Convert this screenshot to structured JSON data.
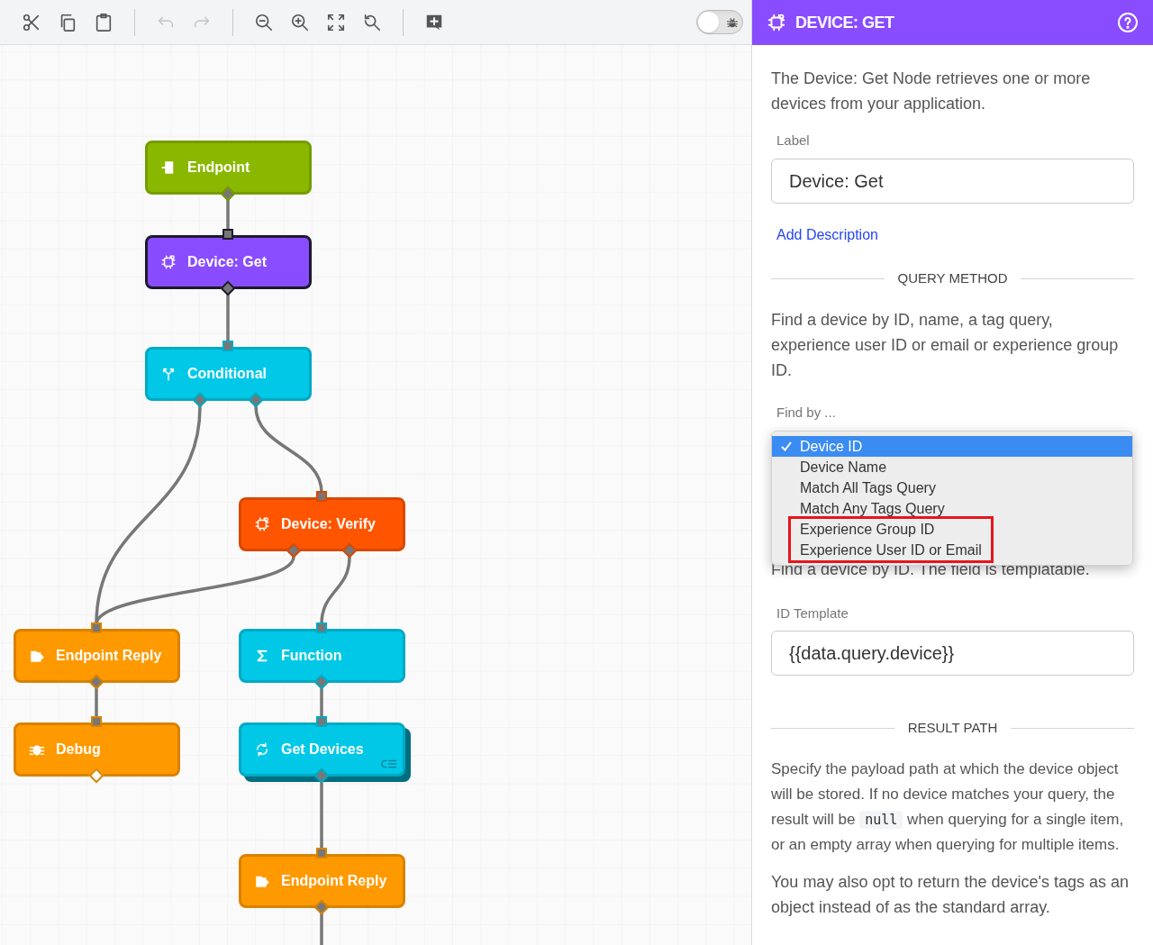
{
  "toolbar": {
    "tools": [
      {
        "kind": "cut",
        "disabled": false
      },
      {
        "kind": "copy",
        "disabled": false
      },
      {
        "kind": "paste",
        "disabled": false
      },
      {
        "kind": "separator"
      },
      {
        "kind": "undo",
        "disabled": true
      },
      {
        "kind": "redo",
        "disabled": true
      },
      {
        "kind": "separator"
      },
      {
        "kind": "zoom-out",
        "disabled": false
      },
      {
        "kind": "zoom-in",
        "disabled": false
      },
      {
        "kind": "fit",
        "disabled": false
      },
      {
        "kind": "zoom-reset",
        "disabled": false
      },
      {
        "kind": "separator"
      },
      {
        "kind": "add-comment",
        "disabled": false
      }
    ],
    "debug_toggle": {
      "on": false
    }
  },
  "canvas": {
    "nodes": [
      {
        "label": "Endpoint",
        "kind": "endpoint",
        "color": "#8ab800",
        "selected": false,
        "open_output": false
      },
      {
        "label": "Device: Get",
        "kind": "device",
        "color": "#8a4cff",
        "selected": true,
        "open_output": false
      },
      {
        "label": "Conditional",
        "kind": "conditional",
        "color": "#00c8e6",
        "selected": false,
        "open_output": false
      },
      {
        "label": "Device: Verify",
        "kind": "device",
        "color": "#ff5500",
        "selected": false,
        "open_output": false
      },
      {
        "label": "Endpoint Reply",
        "kind": "reply",
        "color": "#ff9900",
        "selected": false,
        "open_output": false
      },
      {
        "label": "Function",
        "kind": "function",
        "color": "#00c8e6",
        "selected": false,
        "open_output": false
      },
      {
        "label": "Debug",
        "kind": "debug",
        "color": "#ff9900",
        "selected": false,
        "open_output": true
      },
      {
        "label": "Get Devices",
        "kind": "loop",
        "color": "#00c8e6",
        "selected": false,
        "open_output": false
      },
      {
        "label": "Endpoint Reply",
        "kind": "reply",
        "color": "#ff9900",
        "selected": false,
        "open_output": false
      }
    ]
  },
  "panel": {
    "title": "DEVICE: GET",
    "description": "The Device: Get Node retrieves one or more devices from your application.",
    "label_field": {
      "label": "Label",
      "value": "Device: Get"
    },
    "add_description": "Add Description",
    "query_section": "QUERY METHOD",
    "query_text": "Find a device by ID, name, a tag query, experience user ID or email or experience group ID.",
    "find_by": {
      "label": "Find by ...",
      "options": [
        {
          "label": "Device ID",
          "selected": true,
          "highlighted": false
        },
        {
          "label": "Device Name",
          "selected": false,
          "highlighted": false
        },
        {
          "label": "Match All Tags Query",
          "selected": false,
          "highlighted": false
        },
        {
          "label": "Match Any Tags Query",
          "selected": false,
          "highlighted": false
        },
        {
          "label": "Experience Group ID",
          "selected": false,
          "highlighted": true
        },
        {
          "label": "Experience User ID or Email",
          "selected": false,
          "highlighted": true
        }
      ]
    },
    "find_help": "Find a device by ID. The field is templatable.",
    "id_field": {
      "label": "ID Template",
      "value": "{{data.query.device}}"
    },
    "result_section": "RESULT PATH",
    "result_text": {
      "before": "Specify the payload path at which the device object will be stored. If no device matches your query, the result will be ",
      "code": "null",
      "after": " when querying for a single item, or an empty array when querying for multiple items."
    },
    "tags_text": "You may also opt to return the device's tags as an object instead of as the standard array."
  }
}
